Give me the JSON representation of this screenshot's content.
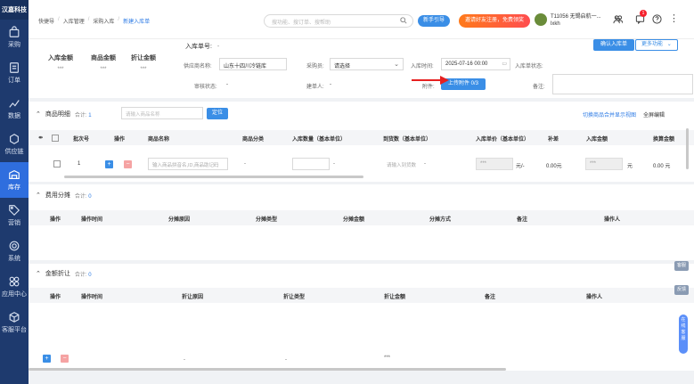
{
  "sidebar": {
    "logo": "汉嘉科技",
    "items": [
      {
        "label": "采购",
        "icon": "shopping-bag-icon"
      },
      {
        "label": "订单",
        "icon": "order-icon"
      },
      {
        "label": "数据",
        "icon": "chart-icon"
      },
      {
        "label": "供应链",
        "icon": "supply-icon"
      },
      {
        "label": "库存",
        "icon": "warehouse-icon",
        "active": true
      },
      {
        "label": "营销",
        "icon": "tag-icon"
      },
      {
        "label": "系统",
        "icon": "gear-icon"
      },
      {
        "label": "应用中心",
        "icon": "apps-icon"
      },
      {
        "label": "客服平台",
        "icon": "cube-icon"
      }
    ]
  },
  "topbar": {
    "breadcrumbs": [
      "快捷导",
      "入库管理",
      "采购入库",
      "新建入库单"
    ],
    "search_placeholder": "搜功能、搜订单、搜帮助",
    "help_button": "新手引导",
    "promo_button": "邀请好友注册，免费领奖",
    "user_line1": "T11056 无锡启航一...",
    "user_line2": "lxkh",
    "message_count": "1"
  },
  "summary": {
    "inbound_amount_label": "入库金额",
    "inbound_amount_value": "***",
    "goods_amount_label": "商品金额",
    "goods_amount_value": "***",
    "discount_amount_label": "折让金额",
    "discount_amount_value": "***"
  },
  "form": {
    "order_no_label": "入库单号:",
    "order_no_value": "-",
    "warehouse_label": "供应商名称:",
    "warehouse_value": "山东十四川冷链库",
    "purchaser_label": "采购员:",
    "purchaser_value": "请选择",
    "date_label": "入库时间:",
    "date_value": "2025-07-16 00:00",
    "inbound_status_label": "入库单状态:",
    "audit_label": "审核状态:",
    "audit_value": "-",
    "creator_label": "建单人:",
    "creator_value": "-",
    "attachment_label": "附件:",
    "attachment_button": "上传附件 0/3",
    "remark_label": "备注:",
    "confirm_button": "确认入库单",
    "more_button": "更多功能"
  },
  "product_section": {
    "title": "商品明细",
    "count_label": "合计:",
    "count_value": "1",
    "search_placeholder": "请输入商品名称",
    "locate_button": "定位",
    "right_link": "切换商品合并显示视图",
    "right_link2": "全屏编辑",
    "columns": [
      "批次号",
      "操作",
      "商品名称",
      "商品分类",
      "入库数量（基本单位）",
      "到货数（基本单位）",
      "入库单价（基本单位）",
      "补差",
      "入库金额",
      "换算金额"
    ],
    "row": {
      "batch": "1",
      "name_placeholder": "输入商品拼音名,ID,商品助记码",
      "category": "-",
      "qty": "-",
      "arrival_placeholder": "请输入到货数",
      "arrival_value": "-",
      "unit_price": "***",
      "unit_suffix": "元/-",
      "diff": "0.00元",
      "amount": "***",
      "amount_suffix": "元",
      "converted": "0.00 元"
    }
  },
  "fee_section": {
    "title": "费用分摊",
    "count_label": "合计:",
    "count_value": "0",
    "columns": [
      "操作",
      "操作时间",
      "分摊原因",
      "分摊类型",
      "分摊金额",
      "分摊方式",
      "备注",
      "操作人"
    ],
    "row": {
      "reason": "-",
      "type": "-",
      "amount": "***",
      "method": "-"
    }
  },
  "discount_section": {
    "title": "金额折让",
    "count_label": "合计:",
    "count_value": "0",
    "columns": [
      "操作",
      "操作时间",
      "折让原因",
      "折让类型",
      "折让金额",
      "备注",
      "操作人"
    ],
    "row": {
      "reason": "-",
      "type": "-",
      "amount": "***"
    }
  },
  "side_tabs": [
    "客服",
    "反馈"
  ],
  "float_service": "在线客服"
}
